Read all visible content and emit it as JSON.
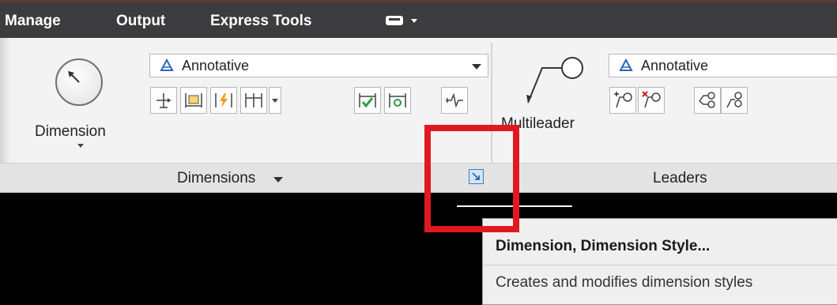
{
  "menu": {
    "tabs": [
      "Manage",
      "Output",
      "Express Tools"
    ]
  },
  "ribbon": {
    "dimensions_panel": {
      "big_button_label": "Dimension",
      "style_dropdown_value": "Annotative",
      "panel_label": "Dimensions",
      "tools": [
        "linear-tool-icon",
        "dim-text-icon",
        "break-icon",
        "continue-icon",
        "adjust-space-icon",
        "inspect-icon",
        "update-icon",
        "jogged-line-icon"
      ]
    },
    "leaders_panel": {
      "big_button_label": "Multileader",
      "style_dropdown_value": "Annotative",
      "panel_label": "Leaders",
      "tools": [
        "add-leader-icon",
        "remove-leader-icon",
        "align-leaders-icon",
        "collect-leaders-icon"
      ]
    }
  },
  "tooltip": {
    "title": "Dimension, Dimension Style...",
    "description": "Creates and modifies dimension styles"
  },
  "colors": {
    "menubar": "#3c3c3e",
    "ribbon": "#f3f3f3",
    "highlight": "#e0191e",
    "launcher": "#3d7fc4"
  }
}
